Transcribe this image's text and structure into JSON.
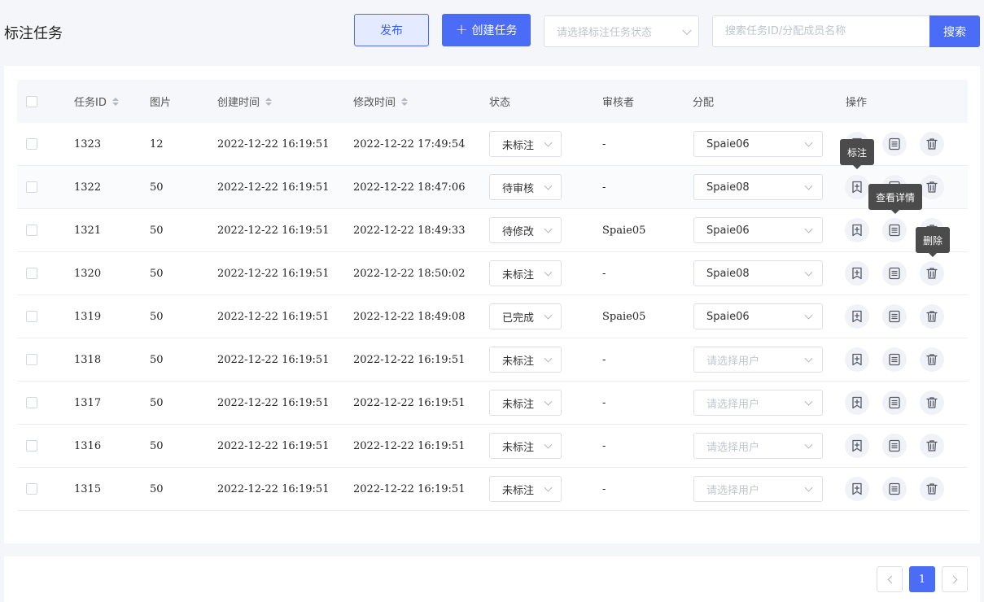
{
  "header": {
    "title": "标注任务",
    "publish_label": "发布",
    "create_label": "创建任务",
    "status_placeholder": "请选择标注任务状态",
    "search_placeholder": "搜索任务ID/分配成员名称",
    "search_label": "搜索"
  },
  "table": {
    "columns": {
      "id": "任务ID",
      "images": "图片",
      "created": "创建时间",
      "modified": "修改时间",
      "status": "状态",
      "reviewer": "审核者",
      "assign": "分配",
      "actions": "操作"
    },
    "assign_placeholder": "请选择用户",
    "rows": [
      {
        "id": "1323",
        "images": "12",
        "created": "2022-12-22 16:19:51",
        "modified": "2022-12-22 17:49:54",
        "status": "未标注",
        "reviewer": "-",
        "assignee": "Spaie06"
      },
      {
        "id": "1322",
        "images": "50",
        "created": "2022-12-22 16:19:51",
        "modified": "2022-12-22 18:47:06",
        "status": "待审核",
        "reviewer": "-",
        "assignee": "Spaie08"
      },
      {
        "id": "1321",
        "images": "50",
        "created": "2022-12-22 16:19:51",
        "modified": "2022-12-22 18:49:33",
        "status": "待修改",
        "reviewer": "Spaie05",
        "assignee": "Spaie06"
      },
      {
        "id": "1320",
        "images": "50",
        "created": "2022-12-22 16:19:51",
        "modified": "2022-12-22 18:50:02",
        "status": "未标注",
        "reviewer": "-",
        "assignee": "Spaie08"
      },
      {
        "id": "1319",
        "images": "50",
        "created": "2022-12-22 16:19:51",
        "modified": "2022-12-22 18:49:08",
        "status": "已完成",
        "reviewer": "Spaie05",
        "assignee": "Spaie06"
      },
      {
        "id": "1318",
        "images": "50",
        "created": "2022-12-22 16:19:51",
        "modified": "2022-12-22 16:19:51",
        "status": "未标注",
        "reviewer": "-",
        "assignee": ""
      },
      {
        "id": "1317",
        "images": "50",
        "created": "2022-12-22 16:19:51",
        "modified": "2022-12-22 16:19:51",
        "status": "未标注",
        "reviewer": "-",
        "assignee": ""
      },
      {
        "id": "1316",
        "images": "50",
        "created": "2022-12-22 16:19:51",
        "modified": "2022-12-22 16:19:51",
        "status": "未标注",
        "reviewer": "-",
        "assignee": ""
      },
      {
        "id": "1315",
        "images": "50",
        "created": "2022-12-22 16:19:51",
        "modified": "2022-12-22 16:19:51",
        "status": "未标注",
        "reviewer": "-",
        "assignee": ""
      }
    ]
  },
  "tooltips": {
    "annotate": "标注",
    "details": "查看详情",
    "delete": "删除"
  },
  "pagination": {
    "current_page": "1"
  },
  "icons": {
    "annotate": "bookmark-plus-icon",
    "details": "document-list-icon",
    "delete": "trash-icon"
  },
  "colors": {
    "primary": "#4a6cf7",
    "publish_bg": "#e4eaff",
    "tooltip_bg": "#4b4b4b"
  }
}
